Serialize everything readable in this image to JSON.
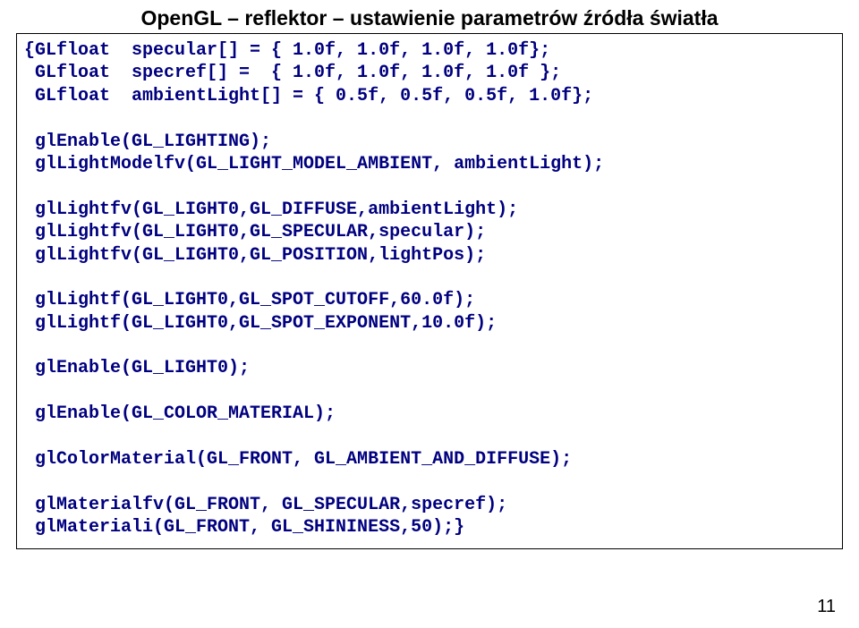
{
  "title": "OpenGL – reflektor – ustawienie parametrów źródła światła",
  "code": {
    "line01": "{GLfloat  specular[] = { 1.0f, 1.0f, 1.0f, 1.0f};",
    "line02": " GLfloat  specref[] =  { 1.0f, 1.0f, 1.0f, 1.0f };",
    "line03": " GLfloat  ambientLight[] = { 0.5f, 0.5f, 0.5f, 1.0f};",
    "line04": "",
    "line05": " glEnable(GL_LIGHTING);",
    "line06": " glLightModelfv(GL_LIGHT_MODEL_AMBIENT, ambientLight);",
    "line07": "",
    "line08": " glLightfv(GL_LIGHT0,GL_DIFFUSE,ambientLight);",
    "line09": " glLightfv(GL_LIGHT0,GL_SPECULAR,specular);",
    "line10": " glLightfv(GL_LIGHT0,GL_POSITION,lightPos);",
    "line11": "",
    "line12": " glLightf(GL_LIGHT0,GL_SPOT_CUTOFF,60.0f);",
    "line13": " glLightf(GL_LIGHT0,GL_SPOT_EXPONENT,10.0f);",
    "line14": "",
    "line15": " glEnable(GL_LIGHT0);",
    "line16": "",
    "line17": " glEnable(GL_COLOR_MATERIAL);",
    "line18": "",
    "line19": " glColorMaterial(GL_FRONT, GL_AMBIENT_AND_DIFFUSE);",
    "line20": "",
    "line21": " glMaterialfv(GL_FRONT, GL_SPECULAR,specref);",
    "line22": " glMateriali(GL_FRONT, GL_SHININESS,50);}"
  },
  "page_number": "11"
}
